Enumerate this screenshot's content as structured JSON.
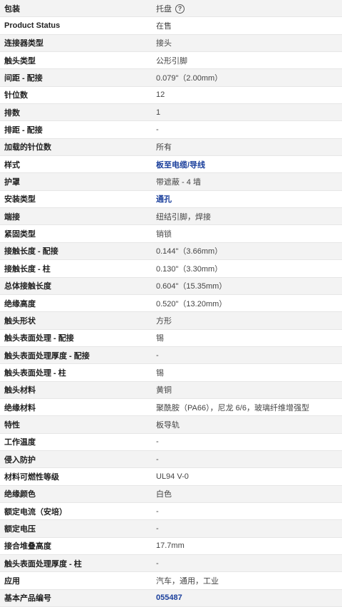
{
  "packaging": {
    "label": "包装",
    "value": "托盘",
    "help_icon": "?"
  },
  "rows": [
    {
      "label": "Product Status",
      "value": "在售",
      "link": false
    },
    {
      "label": "连接器类型",
      "value": "接头",
      "link": false
    },
    {
      "label": "触头类型",
      "value": "公形引脚",
      "link": false
    },
    {
      "label": "间距 - 配接",
      "value": "0.079\"（2.00mm）",
      "link": false
    },
    {
      "label": "针位数",
      "value": "12",
      "link": false
    },
    {
      "label": "排数",
      "value": "1",
      "link": false
    },
    {
      "label": "排距 - 配接",
      "value": "-",
      "link": false
    },
    {
      "label": "加载的针位数",
      "value": "所有",
      "link": false
    },
    {
      "label": "样式",
      "value": "板至电缆/导线",
      "link": true
    },
    {
      "label": "护罩",
      "value": "带遮蔽 - 4 墙",
      "link": false
    },
    {
      "label": "安装类型",
      "value": "通孔",
      "link": true
    },
    {
      "label": "端接",
      "value": "纽结引脚，焊接",
      "link": false
    },
    {
      "label": "紧固类型",
      "value": "销锁",
      "link": false
    },
    {
      "label": "接触长度 - 配接",
      "value": "0.144\"（3.66mm）",
      "link": false
    },
    {
      "label": "接触长度 - 柱",
      "value": "0.130\"（3.30mm）",
      "link": false
    },
    {
      "label": "总体接触长度",
      "value": "0.604\"（15.35mm）",
      "link": false
    },
    {
      "label": "绝缘高度",
      "value": "0.520\"（13.20mm）",
      "link": false
    },
    {
      "label": "触头形状",
      "value": "方形",
      "link": false
    },
    {
      "label": "触头表面处理 - 配接",
      "value": "锡",
      "link": false
    },
    {
      "label": "触头表面处理厚度 - 配接",
      "value": "-",
      "link": false
    },
    {
      "label": "触头表面处理 - 柱",
      "value": "锡",
      "link": false
    },
    {
      "label": "触头材料",
      "value": "黄铜",
      "link": false
    },
    {
      "label": "绝缘材料",
      "value": "聚酰胺（PA66），尼龙 6/6，玻璃纤维增强型",
      "link": false
    },
    {
      "label": "特性",
      "value": "板导轨",
      "link": false
    },
    {
      "label": "工作温度",
      "value": "-",
      "link": false
    },
    {
      "label": "侵入防护",
      "value": "-",
      "link": false
    },
    {
      "label": "材料可燃性等级",
      "value": "UL94 V-0",
      "link": false
    },
    {
      "label": "绝缘颜色",
      "value": "白色",
      "link": false
    },
    {
      "label": "额定电流（安培）",
      "value": "-",
      "link": false
    },
    {
      "label": "额定电压",
      "value": "-",
      "link": false
    },
    {
      "label": "接合堆叠高度",
      "value": "17.7mm",
      "link": false
    },
    {
      "label": "触头表面处理厚度 - 柱",
      "value": "-",
      "link": false
    },
    {
      "label": "应用",
      "value": "汽车，通用，工业",
      "link": false
    },
    {
      "label": "基本产品编号",
      "value": "055487",
      "link": true
    }
  ]
}
